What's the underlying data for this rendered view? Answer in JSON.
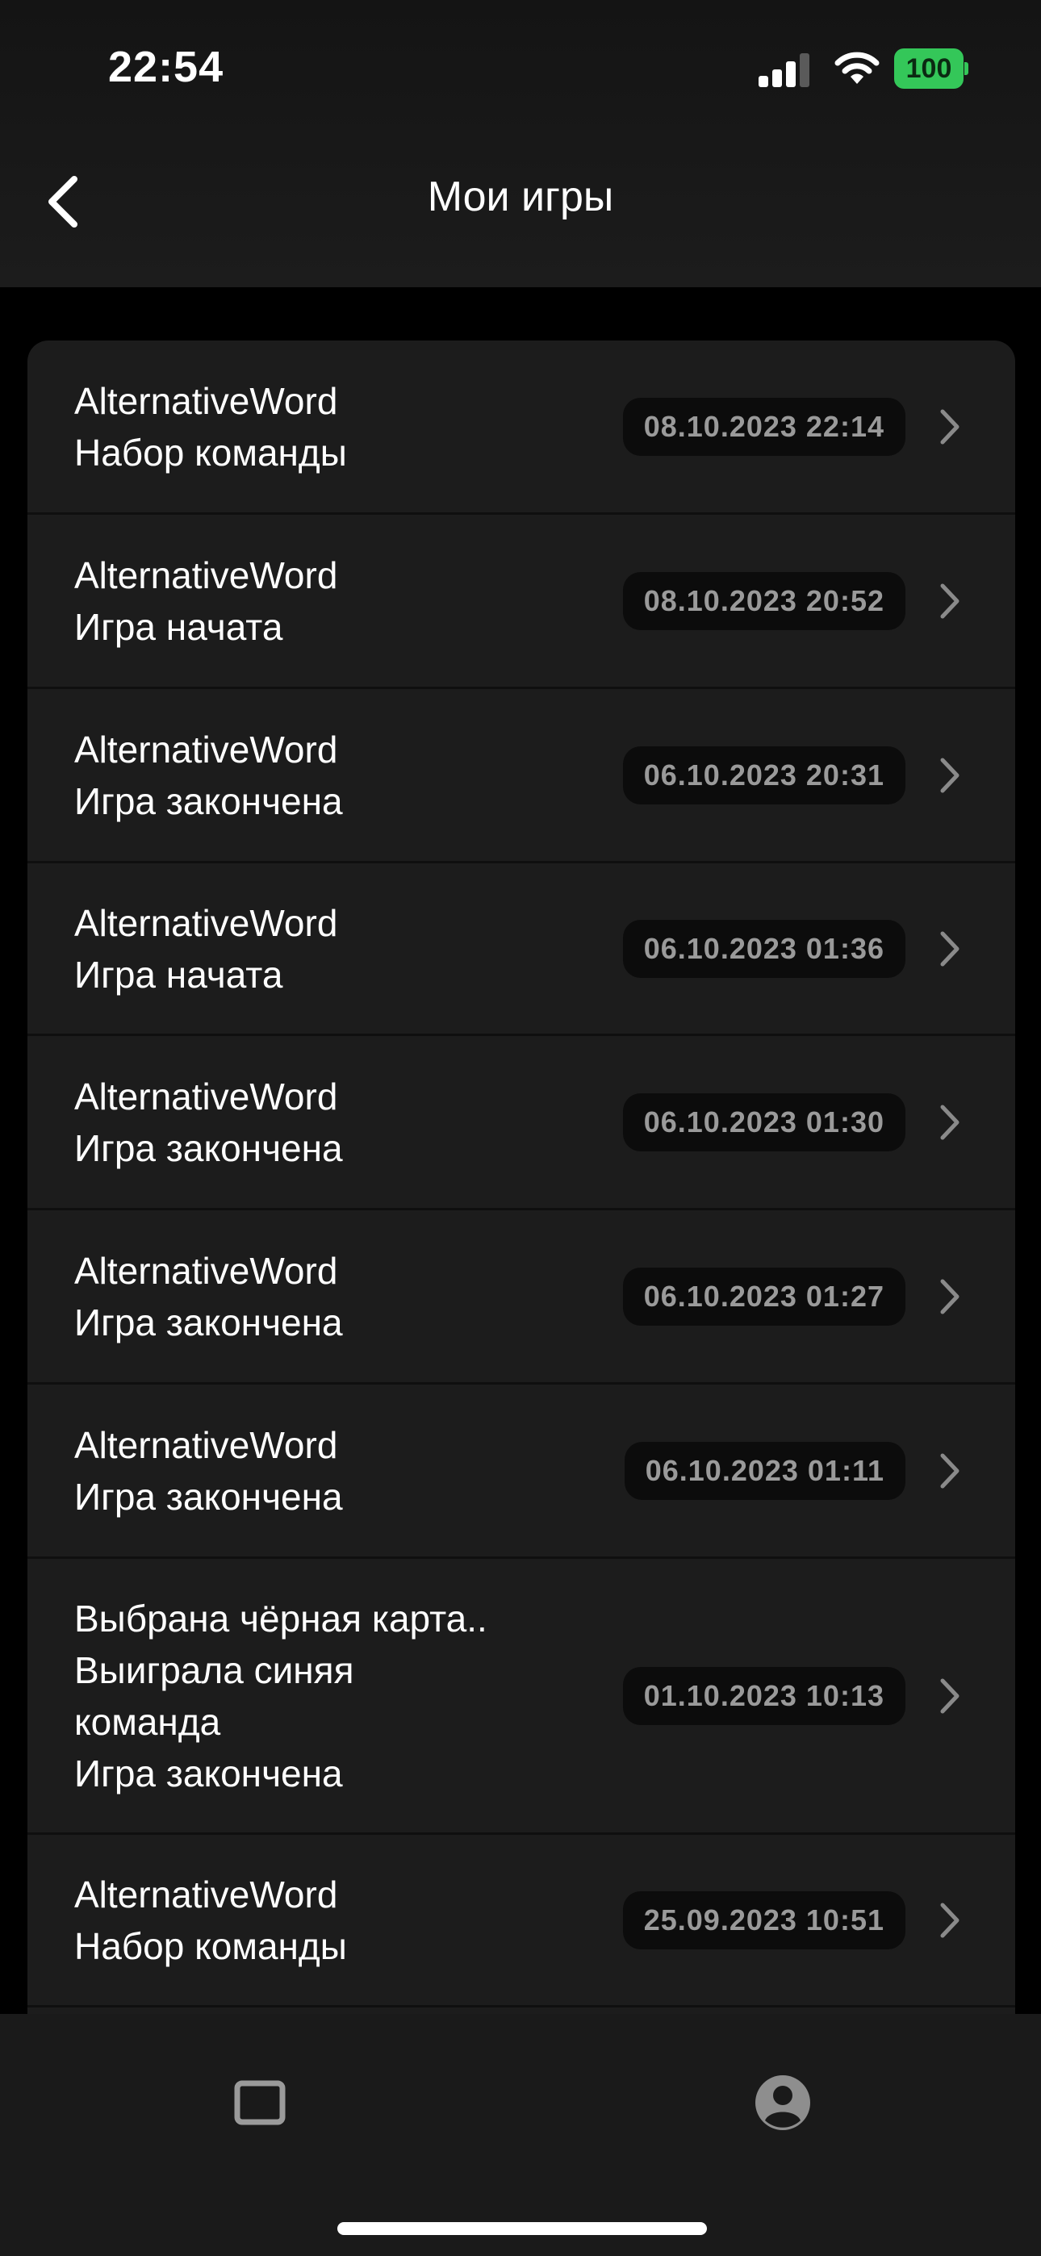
{
  "status_bar": {
    "time": "22:54",
    "battery_level": "100",
    "icons": [
      "signal-icon",
      "wifi-icon",
      "battery-icon"
    ]
  },
  "header": {
    "title": "Мои игры",
    "back_icon": "chevron-left-icon"
  },
  "colors": {
    "background": "#000000",
    "card": "#1c1c1c",
    "pill": "#0c0c0c",
    "pill_text": "#9a9a9a",
    "battery": "#34c759"
  },
  "games": [
    {
      "lines": [
        "AlternativeWord",
        "Набор команды"
      ],
      "date": "08.10.2023 22:14"
    },
    {
      "lines": [
        "AlternativeWord",
        "Игра начата"
      ],
      "date": "08.10.2023 20:52"
    },
    {
      "lines": [
        "AlternativeWord",
        "Игра закончена"
      ],
      "date": "06.10.2023 20:31"
    },
    {
      "lines": [
        "AlternativeWord",
        "Игра начата"
      ],
      "date": "06.10.2023 01:36"
    },
    {
      "lines": [
        "AlternativeWord",
        "Игра закончена"
      ],
      "date": "06.10.2023 01:30"
    },
    {
      "lines": [
        "AlternativeWord",
        "Игра закончена"
      ],
      "date": "06.10.2023 01:27"
    },
    {
      "lines": [
        "AlternativeWord",
        "Игра закончена"
      ],
      "date": "06.10.2023 01:11"
    },
    {
      "lines": [
        "Выбрана чёрная карта..",
        "Выиграла синяя",
        "команда",
        "Игра закончена"
      ],
      "date": "01.10.2023 10:13"
    },
    {
      "lines": [
        "AlternativeWord",
        "Набор команды"
      ],
      "date": "25.09.2023 10:51"
    }
  ],
  "tab_bar": {
    "items": [
      {
        "icon": "square-icon"
      },
      {
        "icon": "profile-icon"
      }
    ]
  }
}
